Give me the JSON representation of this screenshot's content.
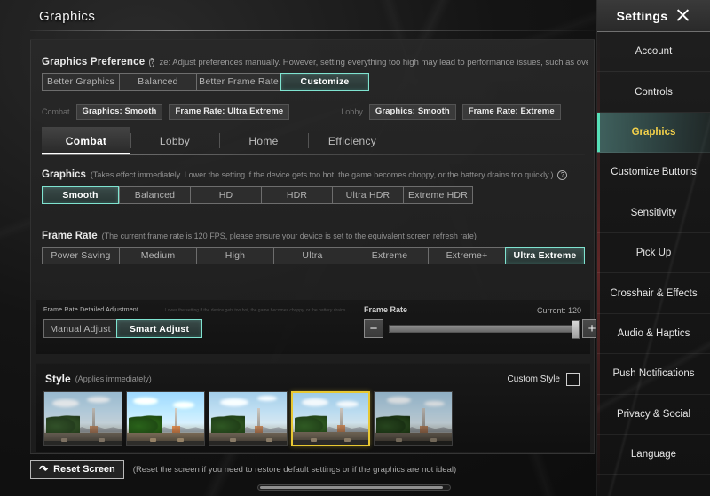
{
  "page": {
    "title": "Graphics"
  },
  "preference": {
    "label": "Graphics Preference",
    "help_icon": "question-mark-icon",
    "description": "ze: Adjust preferences manually. However, setting everything too high may lead to performance issues, such as overheating, b",
    "options": [
      "Better Graphics",
      "Balanced",
      "Better Frame Rate",
      "Customize"
    ],
    "selected": "Customize",
    "summary": {
      "combat_caption": "Combat",
      "combat_graphics": "Graphics: Smooth",
      "combat_framerate": "Frame Rate: Ultra Extreme",
      "lobby_caption": "Lobby",
      "lobby_graphics": "Graphics: Smooth",
      "lobby_framerate": "Frame Rate: Extreme"
    }
  },
  "tabs": {
    "items": [
      "Combat",
      "Lobby",
      "Home",
      "Efficiency"
    ],
    "selected": "Combat"
  },
  "graphics": {
    "label": "Graphics",
    "description": "(Takes effect immediately. Lower the setting if the device gets too hot, the game becomes choppy, or the battery drains too quickly.)",
    "help_icon": "question-mark-icon",
    "options": [
      "Smooth",
      "Balanced",
      "HD",
      "HDR",
      "Ultra HDR",
      "Extreme HDR"
    ],
    "selected": "Smooth"
  },
  "frame_rate": {
    "label": "Frame Rate",
    "description": "(The current frame rate is 120 FPS, please ensure your device is set to the equivalent screen refresh rate)",
    "options": [
      "Power Saving",
      "Medium",
      "High",
      "Ultra",
      "Extreme",
      "Extreme+",
      "Ultra Extreme"
    ],
    "selected": "Ultra Extreme"
  },
  "detailed_adjustment": {
    "title": "Frame Rate Detailed Adjustment",
    "ghost_note": "Lower the setting if the device gets too hot, the game becomes choppy, or the battery drains",
    "slider_label": "Frame Rate",
    "current_label": "Current: 120",
    "options": [
      "Manual Adjust",
      "Smart Adjust"
    ],
    "selected": "Smart Adjust",
    "decrease_icon": "minus-icon",
    "increase_icon": "plus-icon",
    "slider_value": 120,
    "slider_percent": 100
  },
  "style": {
    "label": "Style",
    "description": "(Applies immediately)",
    "custom_style_label": "Custom Style",
    "custom_style_checked": false,
    "thumbnails": [
      {
        "name": "style-1"
      },
      {
        "name": "style-2"
      },
      {
        "name": "style-3"
      },
      {
        "name": "style-4"
      },
      {
        "name": "style-5"
      }
    ],
    "selected_index": 3
  },
  "reset": {
    "icon": "undo-icon",
    "label": "Reset Screen",
    "note": "(Reset the screen if you need to restore default settings or if the graphics are not ideal)"
  },
  "sidebar": {
    "title": "Settings",
    "close_icon": "close-icon",
    "items": [
      "Account",
      "Controls",
      "Graphics",
      "Customize Buttons",
      "Sensitivity",
      "Pick Up",
      "Crosshair & Effects",
      "Audio & Haptics",
      "Push Notifications",
      "Privacy & Social",
      "Language"
    ],
    "selected": "Graphics"
  },
  "colors": {
    "accent_teal": "#7fe3d0",
    "accent_yellow": "#f5d24a",
    "selected_bar": "#57e0b8",
    "thumb_selected_border": "#e8c832"
  }
}
